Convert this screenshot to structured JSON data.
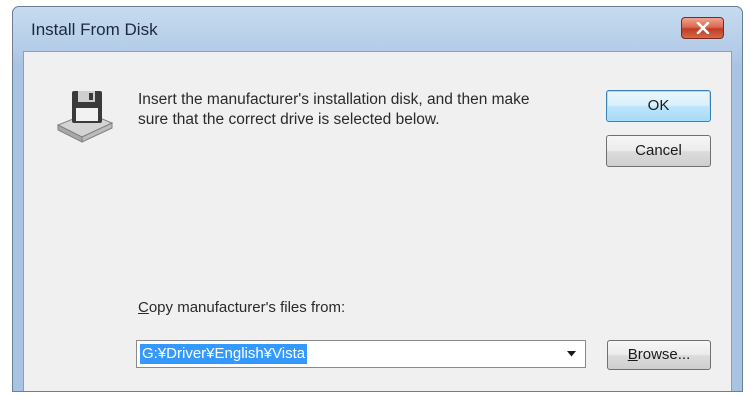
{
  "window": {
    "title": "Install From Disk"
  },
  "message": {
    "text": "Insert the manufacturer's installation disk, and then make sure that the correct drive is selected below."
  },
  "buttons": {
    "ok": "OK",
    "cancel": "Cancel",
    "browse_first": "B",
    "browse_rest": "rowse..."
  },
  "copy_from": {
    "label_first": "C",
    "label_rest": "opy manufacturer's files from:",
    "value": "G:¥Driver¥English¥Vista"
  },
  "icons": {
    "close": "close-icon",
    "disk": "floppy-disk-icon",
    "dropdown": "chevron-down-icon"
  },
  "colors": {
    "selection": "#3399ff",
    "close_button": "#c23b22",
    "dialog_background": "#f0f0f0"
  }
}
